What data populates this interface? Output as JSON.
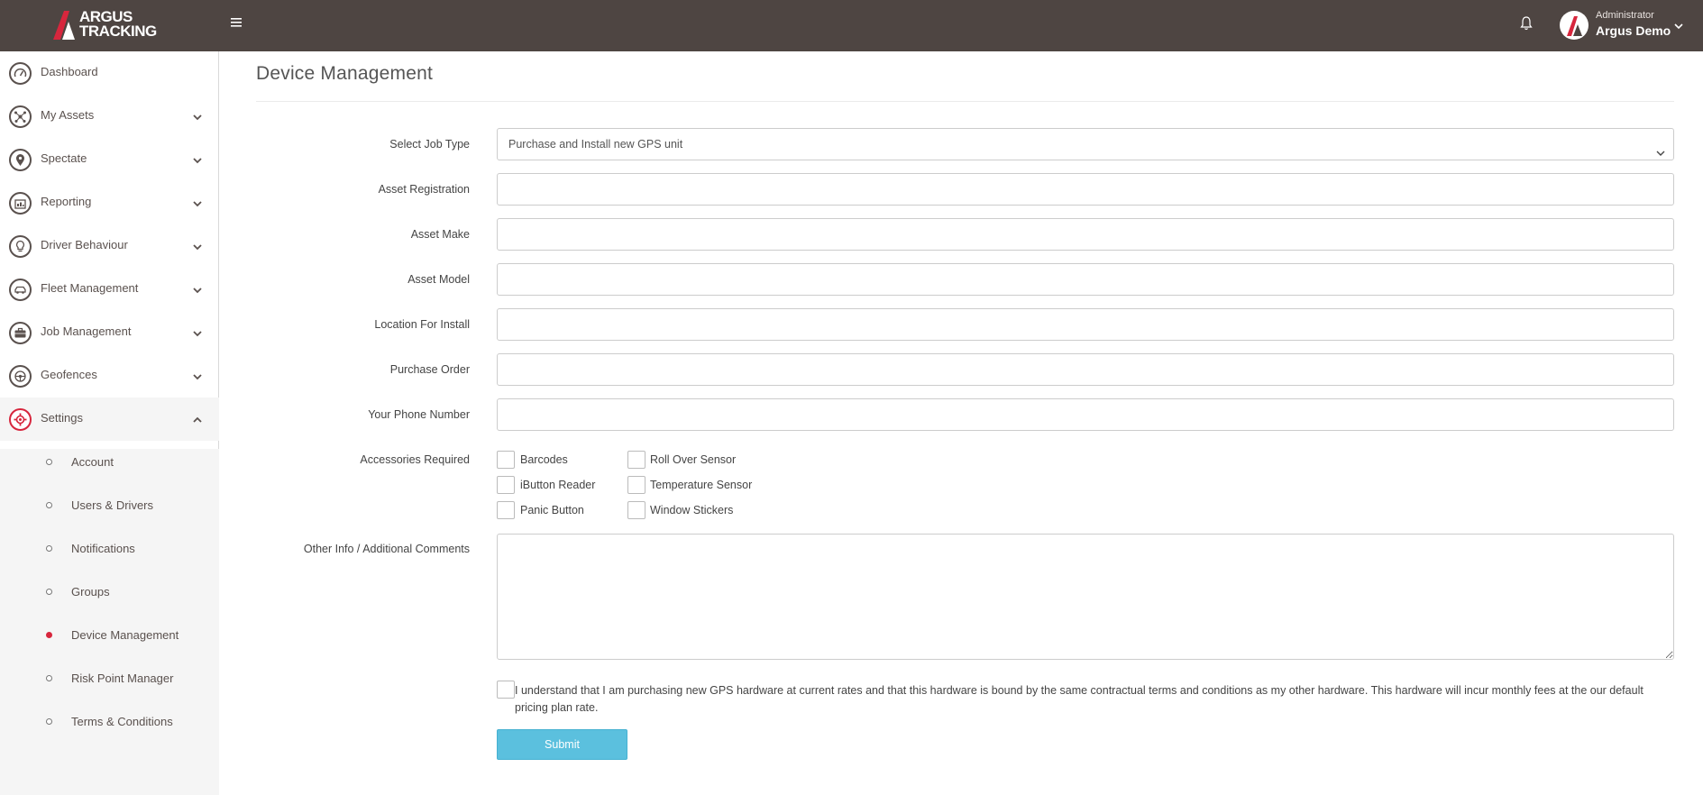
{
  "header": {
    "logo_text": "ARGUS TRACKING",
    "user_role": "Administrator",
    "user_name": "Argus Demo",
    "icons": {
      "menu": "hamburger-icon",
      "notifications": "bell-icon",
      "user_menu": "chevron-down-icon"
    }
  },
  "sidebar": {
    "items": [
      {
        "label": "Dashboard",
        "icon": "speedometer-icon",
        "expandable": false
      },
      {
        "label": "My Assets",
        "icon": "network-icon",
        "expandable": true
      },
      {
        "label": "Spectate",
        "icon": "map-pin-icon",
        "expandable": true
      },
      {
        "label": "Reporting",
        "icon": "report-icon",
        "expandable": true
      },
      {
        "label": "Driver Behaviour",
        "icon": "lightbulb-icon",
        "expandable": true
      },
      {
        "label": "Fleet Management",
        "icon": "car-icon",
        "expandable": true
      },
      {
        "label": "Job Management",
        "icon": "briefcase-icon",
        "expandable": true
      },
      {
        "label": "Geofences",
        "icon": "steering-wheel-icon",
        "expandable": true
      },
      {
        "label": "Settings",
        "icon": "gear-icon",
        "expandable": true,
        "expanded": true
      }
    ],
    "settings_sub": [
      {
        "label": "Account",
        "active": false
      },
      {
        "label": "Users & Drivers",
        "active": false
      },
      {
        "label": "Notifications",
        "active": false
      },
      {
        "label": "Groups",
        "active": false
      },
      {
        "label": "Device Management",
        "active": true
      },
      {
        "label": "Risk Point Manager",
        "active": false
      },
      {
        "label": "Terms & Conditions",
        "active": false
      }
    ]
  },
  "main": {
    "title": "Device Management",
    "form": {
      "job_type_label": "Select Job Type",
      "job_type_value": "Purchase and Install new GPS unit",
      "asset_registration_label": "Asset Registration",
      "asset_registration_value": "",
      "asset_make_label": "Asset Make",
      "asset_make_value": "",
      "asset_model_label": "Asset Model",
      "asset_model_value": "",
      "location_label": "Location For Install",
      "location_value": "",
      "purchase_order_label": "Purchase Order",
      "purchase_order_value": "",
      "phone_label": "Your Phone Number",
      "phone_value": "",
      "accessories_label": "Accessories Required",
      "accessories": [
        {
          "label": "Barcodes",
          "checked": false
        },
        {
          "label": "Roll Over Sensor",
          "checked": false
        },
        {
          "label": "iButton Reader",
          "checked": false
        },
        {
          "label": "Temperature Sensor",
          "checked": false
        },
        {
          "label": "Panic Button",
          "checked": false
        },
        {
          "label": "Window Stickers",
          "checked": false
        }
      ],
      "comments_label": "Other Info / Additional Comments",
      "comments_value": "",
      "terms_text": "I understand that I am purchasing new GPS hardware at current rates and that this hardware is bound by the same contractual terms and conditions as my other hardware. This hardware will incur monthly fees at the our default pricing plan rate.",
      "terms_checked": false,
      "submit_label": "Submit"
    }
  },
  "colors": {
    "topbar": "#4e4542",
    "accent_red": "#d7263d",
    "submit_blue": "#5bc0de"
  }
}
